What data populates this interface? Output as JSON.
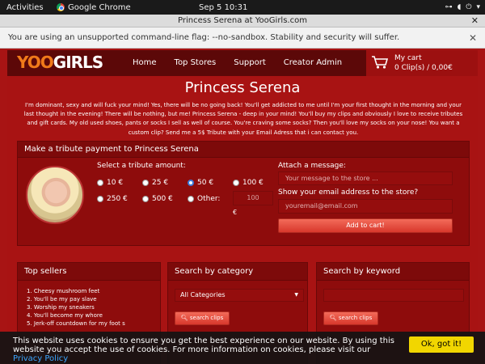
{
  "system_bar": {
    "activities": "Activities",
    "app_name": "Google Chrome",
    "clock": "Sep 5  10:31"
  },
  "window": {
    "title": "Princess Serena at YooGirls.com",
    "close_glyph": "✕"
  },
  "infobar": {
    "message": "You are using an unsupported command-line flag: --no-sandbox. Stability and security will suffer.",
    "close_glyph": "✕"
  },
  "site": {
    "logo_part1": "YOO",
    "logo_part2": "GIRLS",
    "nav": [
      "Home",
      "Top Stores",
      "Support",
      "Creator Admin"
    ],
    "cart": {
      "line1": "My cart",
      "line2": "0 Clip(s) / 0,00€"
    }
  },
  "profile": {
    "name": "Princess Serena",
    "bio": "I'm dominant, sexy and will fuck your mind! Yes, there will be no going back! You'll get addicted to me until I'm your first thought in the morning and your last thought in the evening! There will be nothing, but me! Princess Serena - deep in your mind! You'll buy my clips and obviously I love to receive tributes and gift cards. My old used shoes, pants or socks I sell as well of course. You're craving some socks? Then you'll love my socks on your nose! You want a custom clip? Send me a 5$ Tribute with your Email Adress that i can contact you."
  },
  "tribute": {
    "header": "Make a tribute payment to Princess Serena",
    "select_label": "Select a tribute amount:",
    "options": [
      "10 €",
      "25 €",
      "50 €",
      "100 €",
      "250 €",
      "500 €",
      "Other:"
    ],
    "selected_option": "50 €",
    "other_placeholder": "100",
    "currency": "€",
    "message_label": "Attach a message:",
    "message_placeholder": "Your message to the store ...",
    "email_label": "Show your email address to the store?",
    "email_placeholder": "youremail@email.com",
    "add_button": "Add to cart!"
  },
  "top_sellers": {
    "header": "Top sellers",
    "items": [
      "1. Cheesy mushroom feet",
      "2. You'll be my pay slave",
      "3. Worship my sneakers",
      "4. You'll become my whore",
      "5. Jerk-off countdown for my foot s"
    ]
  },
  "category_search": {
    "header": "Search by category",
    "selected": "All Categories",
    "button": "search clips"
  },
  "keyword_search": {
    "header": "Search by keyword",
    "button": "search clips"
  },
  "cookie": {
    "text": "This website uses cookies to ensure you get the best experience on our website. By using this website you accept the use of cookies. For more information on cookies, please visit our",
    "link": "Privacy Policy",
    "button": "Ok, got it!"
  },
  "colors": {
    "page_bg": "#a81414",
    "nav_bg": "#5c0808",
    "button_red": "#d8382c",
    "cookie_button": "#f1d600",
    "logo_orange": "#f07a1a"
  }
}
